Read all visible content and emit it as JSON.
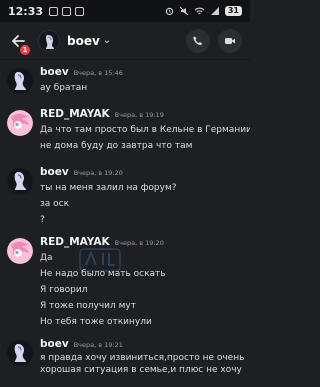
{
  "status_bar": {
    "time": "12:33",
    "battery": "31"
  },
  "header": {
    "back_badge": "1",
    "title": "boev",
    "chevron": "⌄"
  },
  "colors": {
    "accent": "#5865f2",
    "background": "#1e1f22",
    "badge": "#f23f43"
  },
  "messages": [
    {
      "author": "boev",
      "timestamp": "Вчера, в 15:46",
      "lines": [
        "ау братан"
      ]
    },
    {
      "author": "RED_MAYAK",
      "timestamp": "Вчера, в 19:19",
      "lines": [
        "Да что там просто был в Кельне в Германии",
        "не дома буду до завтра что там"
      ]
    },
    {
      "author": "boev",
      "timestamp": "Вчера, в 19:20",
      "lines": [
        "ты на меня залил на форум?",
        "за оск",
        "?"
      ]
    },
    {
      "author": "RED_MAYAK",
      "timestamp": "Вчера, в 19:20",
      "lines": [
        "Да",
        "Не надо было мать оскать",
        "Я говорил",
        "Я тоже получил мут",
        "Но тебя тоже откинули"
      ]
    },
    {
      "author": "boev",
      "timestamp": "Вчера, в 19:21",
      "lines": [
        "я правда хочу извиниться,просто не очень хорошая ситуация в семье,и плюс не хочу"
      ]
    }
  ],
  "icons": [
    "back-arrow-icon",
    "call-icon",
    "video-icon",
    "chevron-down-icon",
    "wifi-icon",
    "signal-icon",
    "alarm-icon"
  ]
}
